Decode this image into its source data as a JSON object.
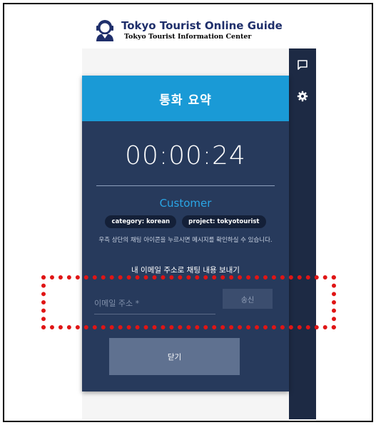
{
  "header": {
    "title": "Tokyo Tourist Online Guide",
    "subtitle": "Tokyo Tourist Information Center",
    "logo_icon": "guide-headset-icon"
  },
  "side_rail": {
    "items": [
      {
        "name": "chat",
        "icon": "chat-bubble-icon"
      },
      {
        "name": "settings",
        "icon": "gear-icon"
      }
    ]
  },
  "call_summary": {
    "title": "통화 요약",
    "timer": "00:00:24",
    "role": "Customer",
    "tags": [
      "category: korean",
      "project: tokyotourist"
    ],
    "hint": "우측 상단의 채팅 아이콘을 누르시면 메시지를 확인하실 수 있습니다.",
    "email_heading": "내 이메일 주소로 채팅 내용 보내기",
    "email_placeholder": "이메일 주소 *",
    "email_value": "",
    "send_label": "송신",
    "close_label": "닫기"
  },
  "colors": {
    "header_blue": "#1a9ad6",
    "panel_bg": "#273a5c",
    "rail_bg": "#1d2a44",
    "role_text": "#2aa6e6",
    "highlight": "#e01515"
  }
}
